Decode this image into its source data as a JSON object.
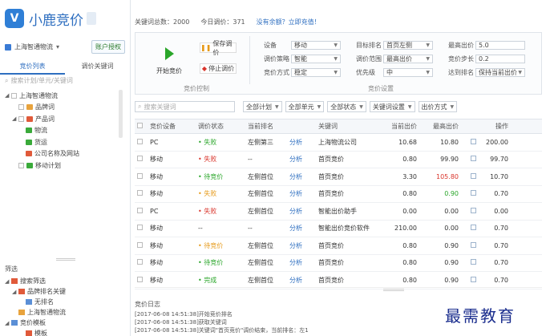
{
  "app": {
    "logo_text": "小鹿竞价"
  },
  "account": {
    "name": "上海智通物流",
    "add_button": "账户授权"
  },
  "left_tabs": [
    "竞价列表",
    "调价关键词"
  ],
  "left_search_placeholder": "搜索计划/单元/关键词",
  "tree": [
    {
      "label": "上海智通物流",
      "level": 0,
      "toggle": "◢",
      "icon": "",
      "check": true
    },
    {
      "label": "品牌词",
      "level": 1,
      "toggle": "",
      "icon": "orange",
      "check": true
    },
    {
      "label": "产品词",
      "level": 1,
      "toggle": "◢",
      "icon": "red",
      "check": true
    },
    {
      "label": "物流",
      "level": 2,
      "toggle": "",
      "icon": "green",
      "check": false
    },
    {
      "label": "货运",
      "level": 2,
      "toggle": "",
      "icon": "green",
      "check": false
    },
    {
      "label": "公司名称及网站",
      "level": 2,
      "toggle": "",
      "icon": "red",
      "check": false
    },
    {
      "label": "移动计划",
      "level": 1,
      "toggle": "",
      "icon": "green",
      "check": true
    }
  ],
  "filter_panel": {
    "title": "筛选",
    "items": [
      {
        "label": "搜索筛选",
        "level": 0,
        "toggle": "◢",
        "icon": "red"
      },
      {
        "label": "品牌排名关键",
        "level": 1,
        "toggle": "◢",
        "icon": "red"
      },
      {
        "label": "无排名",
        "level": 2,
        "toggle": "",
        "icon": "blue"
      },
      {
        "label": "上海智通物流",
        "level": 1,
        "toggle": "",
        "icon": "orange"
      },
      {
        "label": "竞价模板",
        "level": 0,
        "toggle": "◢",
        "icon": "blue"
      },
      {
        "label": "模板",
        "level": 2,
        "toggle": "",
        "icon": "red"
      }
    ]
  },
  "top_info": {
    "total": "关键词总数：2000",
    "today": "今日调价：371",
    "link": "没有余额？立即充值！"
  },
  "toolbar": {
    "start_label": "开始竞价",
    "save_label": "保存调价",
    "stop_label": "停止调价",
    "group_left": "竞价控制",
    "group_right": "竞价设置",
    "fields": [
      {
        "label": "设备",
        "value": "移动"
      },
      {
        "label": "调价策略",
        "value": "智能"
      },
      {
        "label": "竞价方式",
        "value": "稳定"
      },
      {
        "label": "目标排名",
        "value": "首页左侧"
      },
      {
        "label": "调价范围",
        "value": "最高出价"
      },
      {
        "label": "优先级",
        "value": "中"
      },
      {
        "label": "最高出价",
        "value": "5.0"
      },
      {
        "label": "竞价步长",
        "value": "0.2"
      },
      {
        "label": "达到排名",
        "value": "保持当前出价"
      }
    ]
  },
  "filter_bar": {
    "search_placeholder": "搜索关键词",
    "selects": [
      "全部计划",
      "全部单元",
      "全部状态",
      "关键词设置",
      "出价方式"
    ]
  },
  "table": {
    "headers": [
      "",
      "竞价设备",
      "调价状态",
      "当前排名",
      "关键词",
      "当前出价",
      "最高出价",
      "",
      "操作"
    ],
    "analysis_label": "分析",
    "rows": [
      {
        "device": "PC",
        "status": "失败",
        "status_color": "green",
        "rank": "左侧第三",
        "keyword": "上海物流公司",
        "cur": "10.68",
        "max": "10.80",
        "maxc": "",
        "op": "200.00"
      },
      {
        "device": "移动",
        "status": "失败",
        "status_color": "red",
        "rank": "--",
        "keyword": "首页竞价",
        "cur": "0.80",
        "max": "99.90",
        "maxc": "",
        "op": "99.70"
      },
      {
        "device": "移动",
        "status": "待竞价",
        "status_color": "green",
        "rank": "左侧首位",
        "keyword": "首页竞价",
        "cur": "3.30",
        "max": "105.80",
        "maxc": "red",
        "op": "10.70"
      },
      {
        "device": "移动",
        "status": "失败",
        "status_color": "orange",
        "rank": "左侧首位",
        "keyword": "首页竞价",
        "cur": "0.80",
        "max": "0.90",
        "maxc": "green",
        "op": "0.70"
      },
      {
        "device": "PC",
        "status": "失败",
        "status_color": "red",
        "rank": "左侧首位",
        "keyword": "智能出价助手",
        "cur": "0.00",
        "max": "0.00",
        "maxc": "",
        "op": "0.00"
      },
      {
        "device": "移动",
        "status": "--",
        "status_color": "",
        "rank": "--",
        "keyword": "智能出价竞价软件",
        "cur": "210.00",
        "max": "0.00",
        "maxc": "",
        "op": "0.70"
      },
      {
        "device": "移动",
        "status": "待竞价",
        "status_color": "orange",
        "rank": "左侧首位",
        "keyword": "首页竞价",
        "cur": "0.80",
        "max": "0.90",
        "maxc": "",
        "op": "0.70"
      },
      {
        "device": "移动",
        "status": "待竞价",
        "status_color": "green",
        "rank": "左侧首位",
        "keyword": "首页竞价",
        "cur": "0.80",
        "max": "0.90",
        "maxc": "",
        "op": "0.70"
      },
      {
        "device": "移动",
        "status": "完成",
        "status_color": "green",
        "rank": "左侧首位",
        "keyword": "首页竞价",
        "cur": "0.80",
        "max": "0.90",
        "maxc": "",
        "op": "0.70"
      }
    ]
  },
  "log": {
    "title": "竞价日志",
    "lines": [
      "[2017-06-08 14:51:38]开始竞价排名",
      "[2017-06-08 14:51:38]获取关键词",
      "[2017-06-08 14:51:38]关键词\"首页竞价\"调价结束，当前排名：左1"
    ]
  },
  "watermark": "最需教育"
}
